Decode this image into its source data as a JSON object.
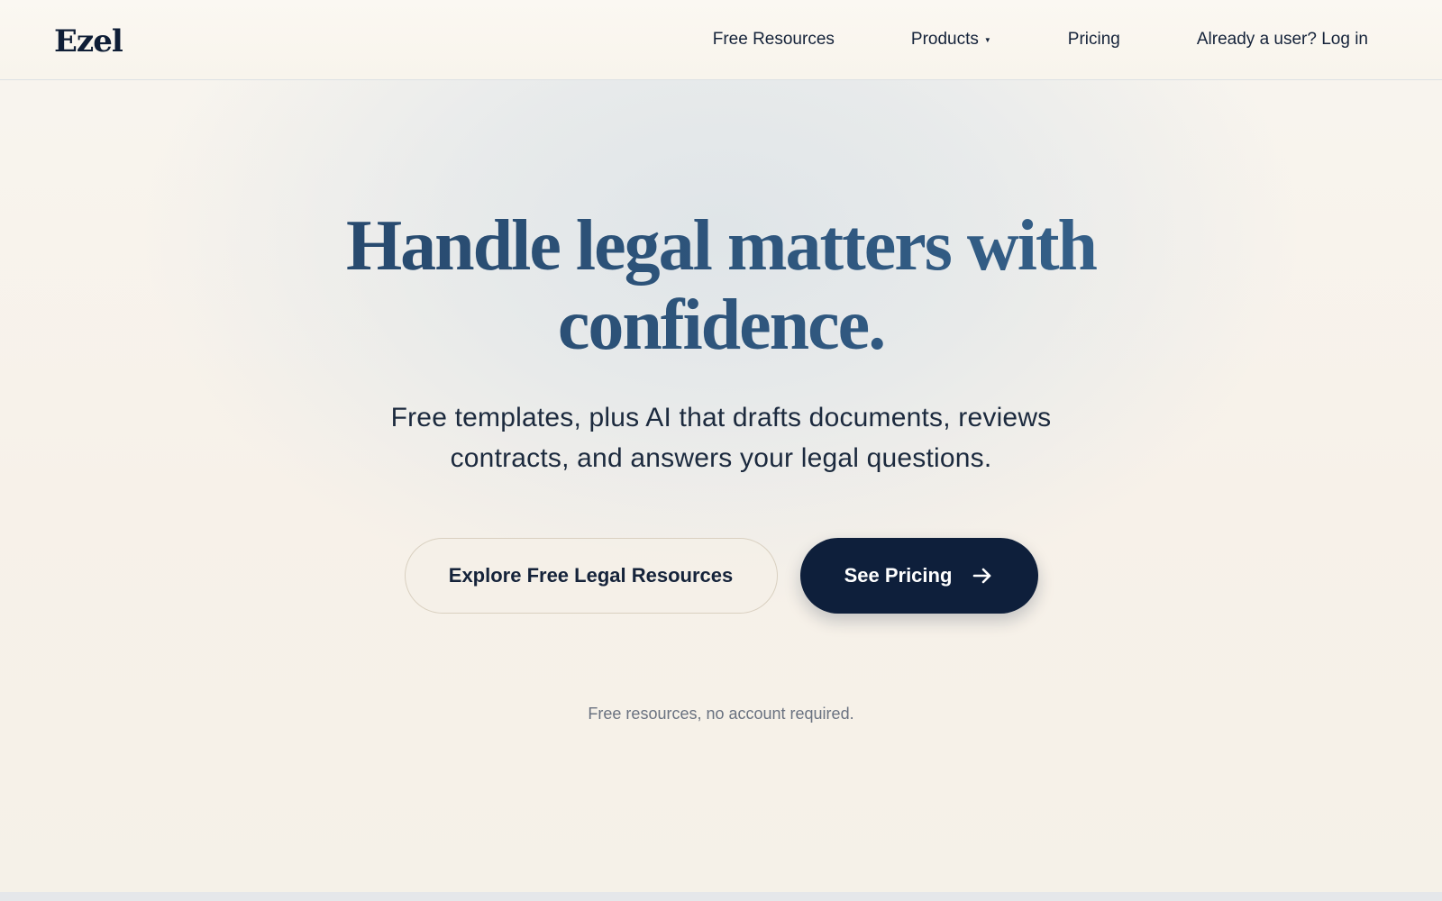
{
  "header": {
    "logo": "Ezel",
    "nav": {
      "free_resources": "Free Resources",
      "products": "Products",
      "pricing": "Pricing",
      "login": "Already a user? Log in"
    },
    "products_caret_icon": "caret-down-icon"
  },
  "hero": {
    "headline_line1": "Handle legal matters with",
    "headline_line2": "confidence.",
    "subhead_line1": "Free templates, plus AI that drafts documents, reviews",
    "subhead_line2": "contracts, and answers your legal questions.",
    "cta_secondary": "Explore Free Legal Resources",
    "cta_primary": "See Pricing",
    "cta_primary_icon": "arrow-right-icon",
    "note": "Free resources, no account required."
  },
  "colors": {
    "navy": "#0e1f3b",
    "headline_blue": "#2b4d72",
    "background_cream": "#f8f4ec"
  }
}
